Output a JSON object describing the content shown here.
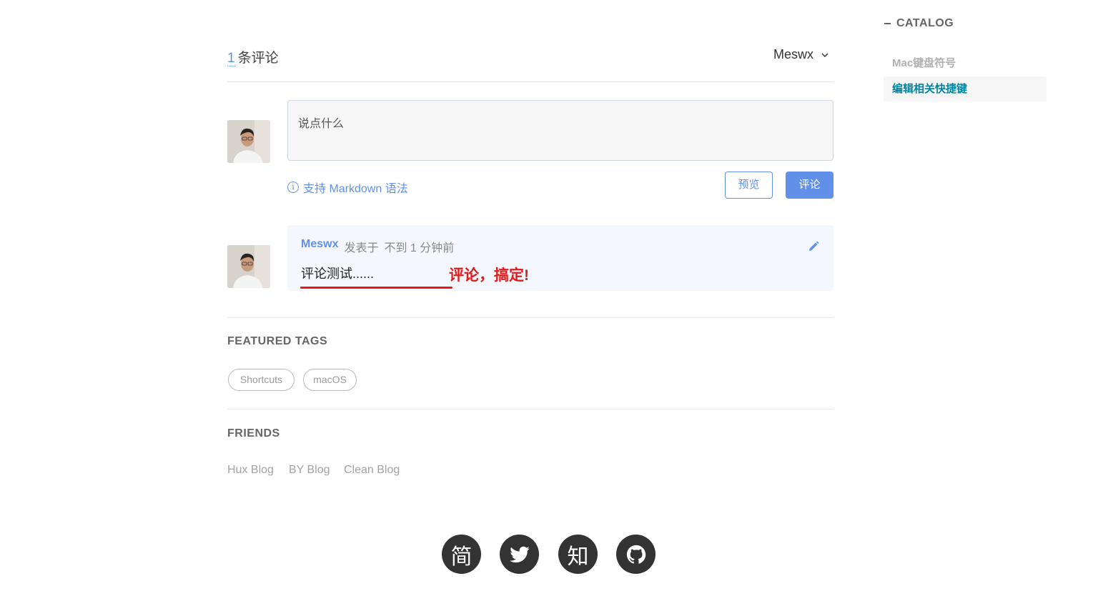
{
  "comments": {
    "count": "1",
    "count_label": "条评论",
    "user_menu": "Meswx",
    "editor_placeholder": "说点什么",
    "markdown_tip": "支持 Markdown 语法",
    "preview_label": "预览",
    "submit_label": "评论",
    "items": [
      {
        "author": "Meswx",
        "posted_label": "发表于",
        "time": "不到 1 分钟前",
        "body": "评论测试......"
      }
    ],
    "annotation": "评论，搞定!"
  },
  "featured_tags": {
    "title": "FEATURED TAGS",
    "tags": [
      "Shortcuts",
      "macOS"
    ]
  },
  "friends": {
    "title": "FRIENDS",
    "links": [
      "Hux Blog",
      "BY Blog",
      "Clean Blog"
    ]
  },
  "social": {
    "jianshu": "简",
    "zhihu": "知"
  },
  "catalog": {
    "title": "CATALOG",
    "items": [
      "Mac键盘符号",
      "编辑相关快捷键"
    ]
  },
  "colors": {
    "accent": "#6190e8",
    "catalog_active": "#0085a1",
    "annotation": "#e21a1a"
  }
}
